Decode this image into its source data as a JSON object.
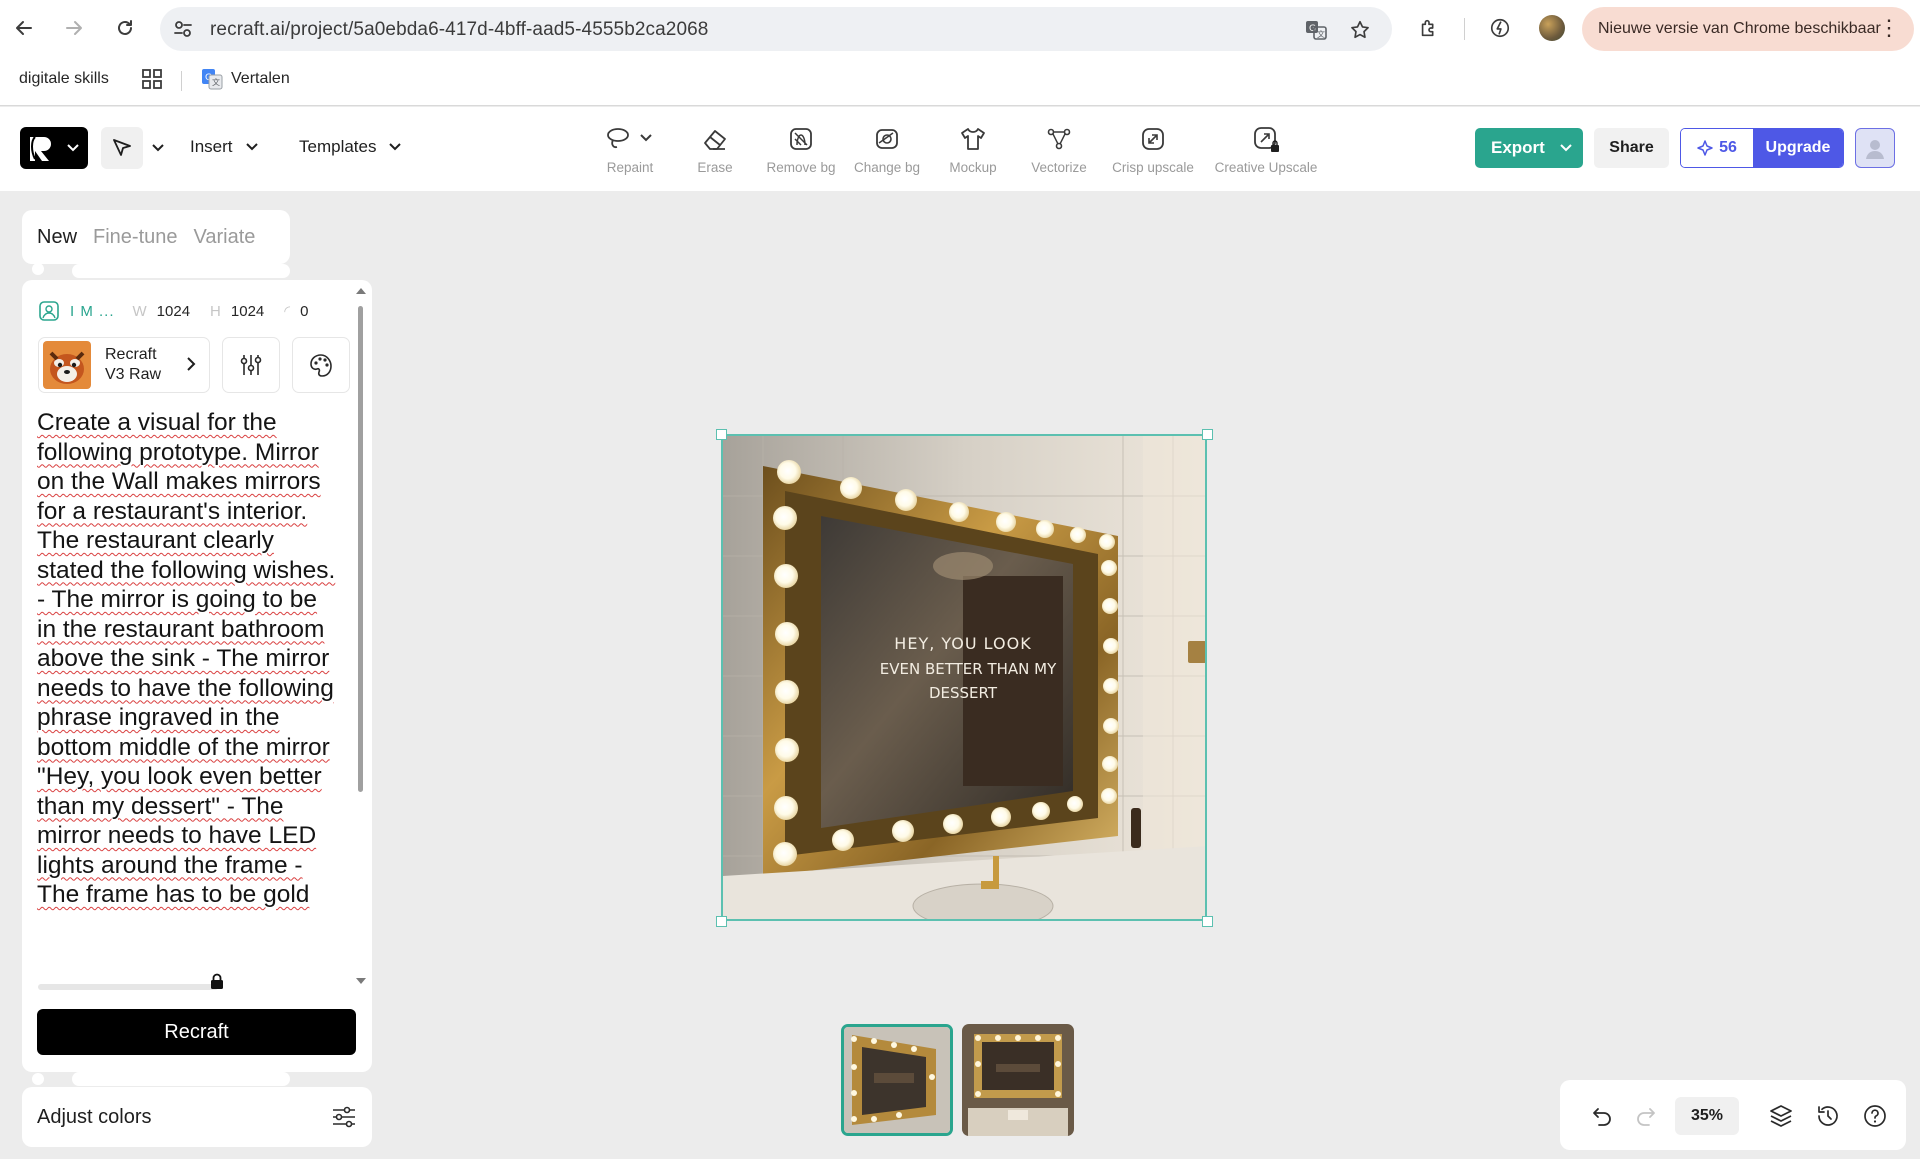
{
  "browser": {
    "url": "recraft.ai/project/5a0ebda6-417d-4bff-aad5-4555b2ca2068",
    "update_notice": "Nieuwe versie van Chrome beschikbaar",
    "bookmarks": [
      {
        "label": "digitale skills"
      },
      {
        "label": "Vertalen"
      }
    ]
  },
  "toolbar": {
    "insert_label": "Insert",
    "templates_label": "Templates",
    "tools": [
      {
        "label": "Repaint",
        "icon": "lasso-icon"
      },
      {
        "label": "Erase",
        "icon": "eraser-icon"
      },
      {
        "label": "Remove bg",
        "icon": "remove-bg-icon"
      },
      {
        "label": "Change bg",
        "icon": "change-bg-icon"
      },
      {
        "label": "Mockup",
        "icon": "tshirt-icon"
      },
      {
        "label": "Vectorize",
        "icon": "vector-nodes-icon"
      },
      {
        "label": "Crisp upscale",
        "icon": "upscale-icon"
      },
      {
        "label": "Creative Upscale",
        "icon": "creative-upscale-icon"
      }
    ],
    "export_label": "Export",
    "share_label": "Share",
    "credits": "56",
    "upgrade_label": "Upgrade",
    "accent_color": "#2aa58e",
    "brand_blue": "#4e58e6"
  },
  "panel": {
    "tabs": [
      {
        "label": "New",
        "active": true
      },
      {
        "label": "Fine-tune",
        "active": false
      },
      {
        "label": "Variate",
        "active": false
      }
    ],
    "image_type": "I M ...",
    "width_label": "W",
    "width": "1024",
    "height_label": "H",
    "height": "1024",
    "seed": "0",
    "model": "Recraft V3 Raw",
    "prompt": "Create a visual for the following prototype. Mirror on the Wall makes mirrors for a restaurant's interior. The restaurant clearly stated the following wishes. - The mirror is going to be in the restaurant bathroom above the sink - The mirror needs to have the following phrase ingraved in the bottom middle of the mirror \"Hey, you look even better than my dessert\" - The mirror needs to have LED lights around the frame - The frame has to be gold",
    "recraft_label": "Recraft",
    "adjust_colors_label": "Adjust colors"
  },
  "canvas": {
    "image_text_line1": "HEY, YOU LOOK",
    "image_text_line2": "EVEN BETTER THAN MY",
    "image_text_line3": "DESSERT",
    "zoom": "35%",
    "thumbnails": [
      {
        "name": "variant-1",
        "selected": true
      },
      {
        "name": "variant-2",
        "selected": false
      }
    ]
  }
}
